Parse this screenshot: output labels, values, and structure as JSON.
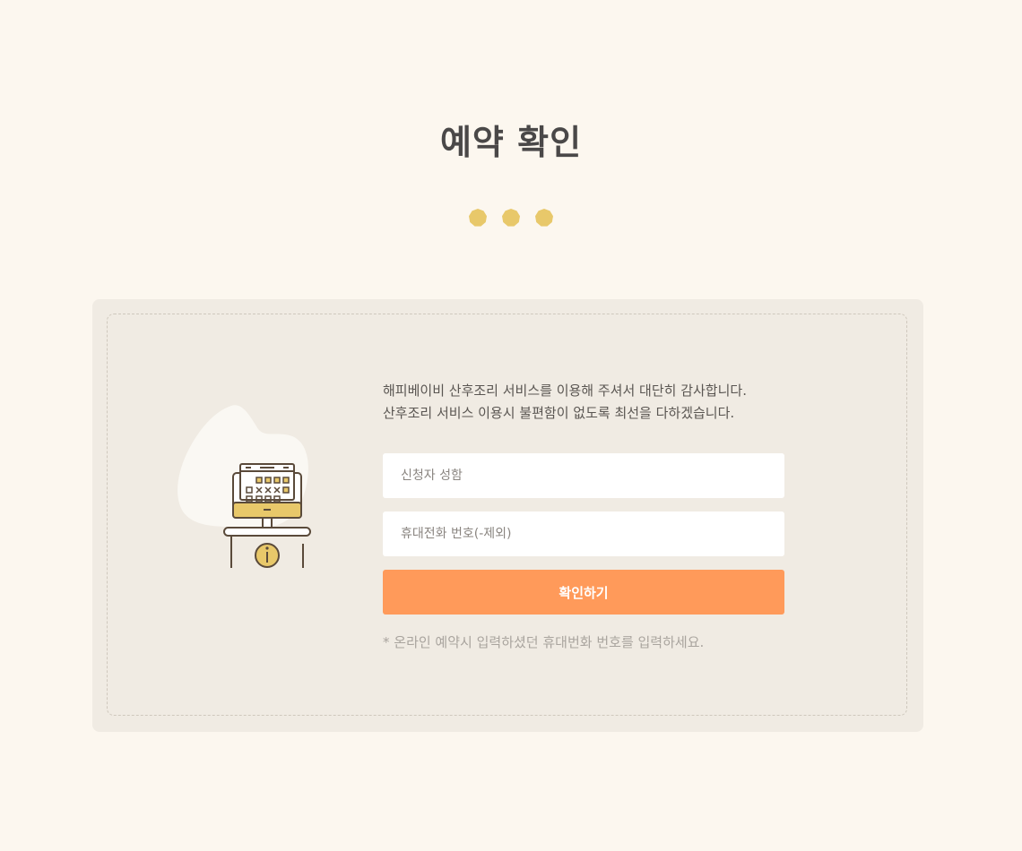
{
  "page": {
    "title": "예약 확인",
    "accent_color": "#e8c86a",
    "button_color": "#ff9a5a",
    "background_color": "#fcf7ef",
    "card_color": "#f0ebe3"
  },
  "decor": {
    "dots_count": 3
  },
  "form": {
    "intro_line1": "해피베이비 산후조리 서비스를 이용해 주셔서 대단히 감사합니다.",
    "intro_line2": "산후조리 서비스 이용시 불편함이 없도록 최선을 다하겠습니다.",
    "name_placeholder": "신청자 성함",
    "name_value": "",
    "phone_placeholder": "휴대전화 번호(-제외)",
    "phone_value": "",
    "submit_label": "확인하기",
    "note": "* 온라인 예약시 입력하셨던 휴대번화 번호를 입력하세요."
  },
  "illustration": {
    "icon": "calendar-kiosk-icon",
    "info_icon": "info-icon"
  }
}
